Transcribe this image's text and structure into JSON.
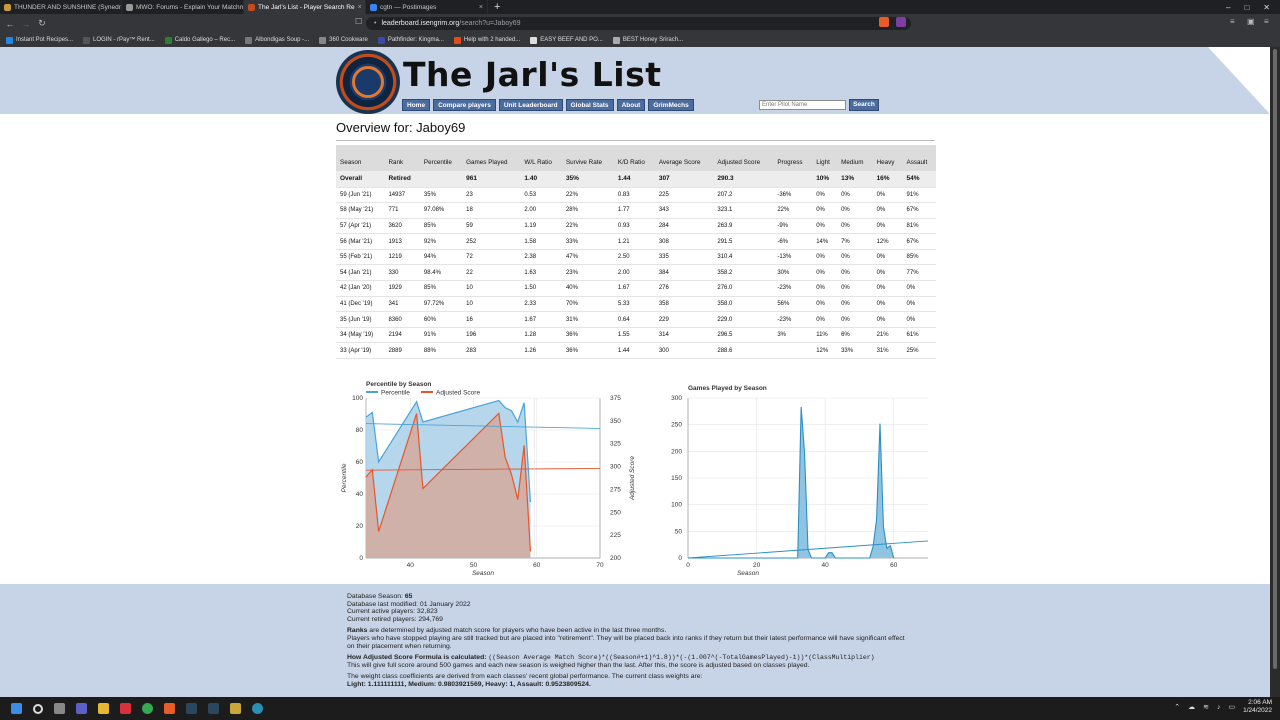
{
  "browser": {
    "tabs": [
      {
        "title": "THUNDER AND SUNSHINE (Synedrion",
        "color": "#c79a3a"
      },
      {
        "title": "MWO: Forums - Explain Your Matchm",
        "color": "#999999"
      },
      {
        "title": "The Jarl's List - Player Search Re",
        "color": "#c24c1a",
        "active": true
      },
      {
        "title": "cgtn — Postimages",
        "color": "#3b82f6"
      }
    ],
    "new_tab": "+",
    "url_host": "leaderboard.isengrim.org",
    "url_path": "/search?u=Jaboy69",
    "bookmarks": [
      {
        "label": "Instant Pot Recipes...",
        "color": "#1e88e5"
      },
      {
        "label": "LOGIN - rPay™ Rent...",
        "color": "#555555"
      },
      {
        "label": "Caldo Gallego – Rec...",
        "color": "#2e7d32"
      },
      {
        "label": "Albondigas Soup -...",
        "color": "#777777"
      },
      {
        "label": "360 Cookware",
        "color": "#888888"
      },
      {
        "label": "Pathfinder: Kingma...",
        "color": "#3949ab"
      },
      {
        "label": "Help with 2 handed...",
        "color": "#e64a19"
      },
      {
        "label": "EASY BEEF AND PO...",
        "color": "#dddddd"
      },
      {
        "label": "BEST Honey Srirach...",
        "color": "#aaaaaa"
      }
    ]
  },
  "site": {
    "title": "The Jarl's List",
    "nav": [
      "Home",
      "Compare players",
      "Unit Leaderboard",
      "Global Stats",
      "About",
      "GrimMechs"
    ],
    "search_placeholder": "Enter Pilot Name",
    "search_button": "Search"
  },
  "overview": {
    "title": "Overview for: Jaboy69"
  },
  "table": {
    "headers": [
      "Season",
      "Rank",
      "Percentile",
      "Games Played",
      "W/L Ratio",
      "Survive Rate",
      "K/D Ratio",
      "Average Score",
      "Adjusted Score",
      "Progress",
      "Light",
      "Medium",
      "Heavy",
      "Assault"
    ],
    "overall": [
      "Overall",
      "Retired",
      "",
      "961",
      "1.40",
      "35%",
      "1.44",
      "307",
      "290.3",
      "",
      "10%",
      "13%",
      "16%",
      "54%"
    ],
    "rows": [
      [
        "59 (Jun '21)",
        "14937",
        "35%",
        "23",
        "0.53",
        "22%",
        "0.83",
        "225",
        "207.2",
        "-36%",
        "0%",
        "0%",
        "0%",
        "91%"
      ],
      [
        "58 (May '21)",
        "771",
        "97.08%",
        "18",
        "2.00",
        "28%",
        "1.77",
        "343",
        "323.1",
        "22%",
        "0%",
        "0%",
        "0%",
        "67%"
      ],
      [
        "57 (Apr '21)",
        "3620",
        "85%",
        "59",
        "1.19",
        "22%",
        "0.93",
        "284",
        "263.9",
        "-9%",
        "0%",
        "0%",
        "0%",
        "81%"
      ],
      [
        "56 (Mar '21)",
        "1913",
        "92%",
        "252",
        "1.58",
        "33%",
        "1.21",
        "308",
        "291.5",
        "-6%",
        "14%",
        "7%",
        "12%",
        "67%"
      ],
      [
        "55 (Feb '21)",
        "1219",
        "94%",
        "72",
        "2.38",
        "47%",
        "2.50",
        "335",
        "310.4",
        "-13%",
        "0%",
        "0%",
        "0%",
        "85%"
      ],
      [
        "54 (Jan '21)",
        "330",
        "98.4%",
        "22",
        "1.63",
        "23%",
        "2.00",
        "384",
        "358.2",
        "30%",
        "0%",
        "0%",
        "0%",
        "77%"
      ],
      [
        "42 (Jan '20)",
        "1929",
        "85%",
        "10",
        "1.50",
        "40%",
        "1.67",
        "276",
        "276.0",
        "-23%",
        "0%",
        "0%",
        "0%",
        "0%"
      ],
      [
        "41 (Dec '19)",
        "341",
        "97.72%",
        "10",
        "2.33",
        "70%",
        "5.33",
        "358",
        "358.0",
        "56%",
        "0%",
        "0%",
        "0%",
        "0%"
      ],
      [
        "35 (Jun '19)",
        "8360",
        "60%",
        "16",
        "1.67",
        "31%",
        "0.64",
        "229",
        "229.0",
        "-23%",
        "0%",
        "0%",
        "0%",
        "0%"
      ],
      [
        "34 (May '19)",
        "2194",
        "91%",
        "196",
        "1.28",
        "36%",
        "1.55",
        "314",
        "296.5",
        "3%",
        "11%",
        "6%",
        "21%",
        "61%"
      ],
      [
        "33 (Apr '19)",
        "2889",
        "88%",
        "283",
        "1.26",
        "36%",
        "1.44",
        "300",
        "288.6",
        "",
        "12%",
        "33%",
        "31%",
        "25%"
      ]
    ]
  },
  "chart_data": [
    {
      "type": "area",
      "title": "Percentile by Season",
      "xlabel": "Season",
      "ylabel": "Percentile",
      "y2label": "Adjusted Score",
      "xlim": [
        33,
        70
      ],
      "xticks": [
        40,
        50,
        60,
        70
      ],
      "ylim": [
        0,
        100
      ],
      "yticks": [
        0,
        20,
        40,
        60,
        80,
        100
      ],
      "y2lim": [
        200,
        375
      ],
      "y2ticks": [
        200,
        225,
        250,
        275,
        300,
        325,
        350,
        375
      ],
      "series": [
        {
          "name": "Percentile",
          "axis": "left",
          "color": "#4aa3d6",
          "fill": "#a9d0e8",
          "x": [
            33,
            34,
            35,
            41,
            42,
            54,
            55,
            56,
            57,
            58,
            59
          ],
          "y": [
            88,
            91,
            60,
            97.72,
            85,
            98.4,
            94,
            92,
            85,
            97.08,
            35
          ]
        },
        {
          "name": "Adjusted Score",
          "axis": "right",
          "color": "#e8552a",
          "fill": "#d6a79a",
          "x": [
            33,
            34,
            35,
            41,
            42,
            54,
            55,
            56,
            57,
            58,
            59
          ],
          "y": [
            288.6,
            296.5,
            229.0,
            358.0,
            276.0,
            358.2,
            310.4,
            291.5,
            263.9,
            323.1,
            207.2
          ]
        }
      ],
      "trend_lines": [
        {
          "axis": "left",
          "color": "#4aa3d6",
          "y_start": 84,
          "y_end": 81
        },
        {
          "axis": "right",
          "color": "#e8552a",
          "y_start": 296,
          "y_end": 298
        }
      ]
    },
    {
      "type": "area",
      "title": "Games Played by Season",
      "xlabel": "Season",
      "ylabel": "",
      "xlim": [
        0,
        70
      ],
      "xticks": [
        0,
        20,
        40,
        60
      ],
      "ylim": [
        0,
        300
      ],
      "yticks": [
        0,
        50,
        100,
        150,
        200,
        250,
        300
      ],
      "series": [
        {
          "name": "Games Played",
          "color": "#2a8fc4",
          "fill": "#8fc5e2",
          "x": [
            0,
            32,
            33,
            34,
            35,
            36,
            40,
            41,
            42,
            43,
            53,
            54,
            55,
            56,
            57,
            58,
            59,
            60
          ],
          "y": [
            0,
            0,
            283,
            196,
            16,
            0,
            0,
            10,
            10,
            0,
            0,
            22,
            72,
            252,
            59,
            18,
            23,
            0
          ]
        }
      ],
      "trend_lines": [
        {
          "color": "#2a8fc4",
          "y_start": 0,
          "y_end": 32
        }
      ]
    }
  ],
  "footer": {
    "db_season_label": "Database Season:",
    "db_season": "65",
    "db_modified": "Database last modified: 01 January 2022",
    "active_players": "Current active players: 32,823",
    "retired_players": "Current retired players: 294,769",
    "ranks_bold": "Ranks",
    "ranks_text": " are determined by adjusted match score for players who have been active in the last three months.",
    "ranks_text2": "Players who have stopped playing are still tracked but are placed into \"retirement\". They will be placed back into ranks if they return but their latest performance will have significant effect on their placement when returning.",
    "formula_label": "How Adjusted Score Formula is calculated:",
    "formula": "((Season Average Match Score)*((Season#+1)^1.8))*(-(1.007^(-TotalGamesPlayed)-1))*(ClassMultiplier)",
    "formula_note": "This will give full score around 500 games and each new season is weighed higher than the last. After this, the score is adjusted based on classes played.",
    "weights_text": "The weight class coefficients are derived from each classes' recent global performance. The current class weights are:",
    "weights": "Light: 1.111111111, Medium: 0.9803921569, Heavy: 1, Assault: 0.9523809524."
  },
  "taskbar": {
    "time": "2:06 AM",
    "date": "1/24/2022"
  }
}
